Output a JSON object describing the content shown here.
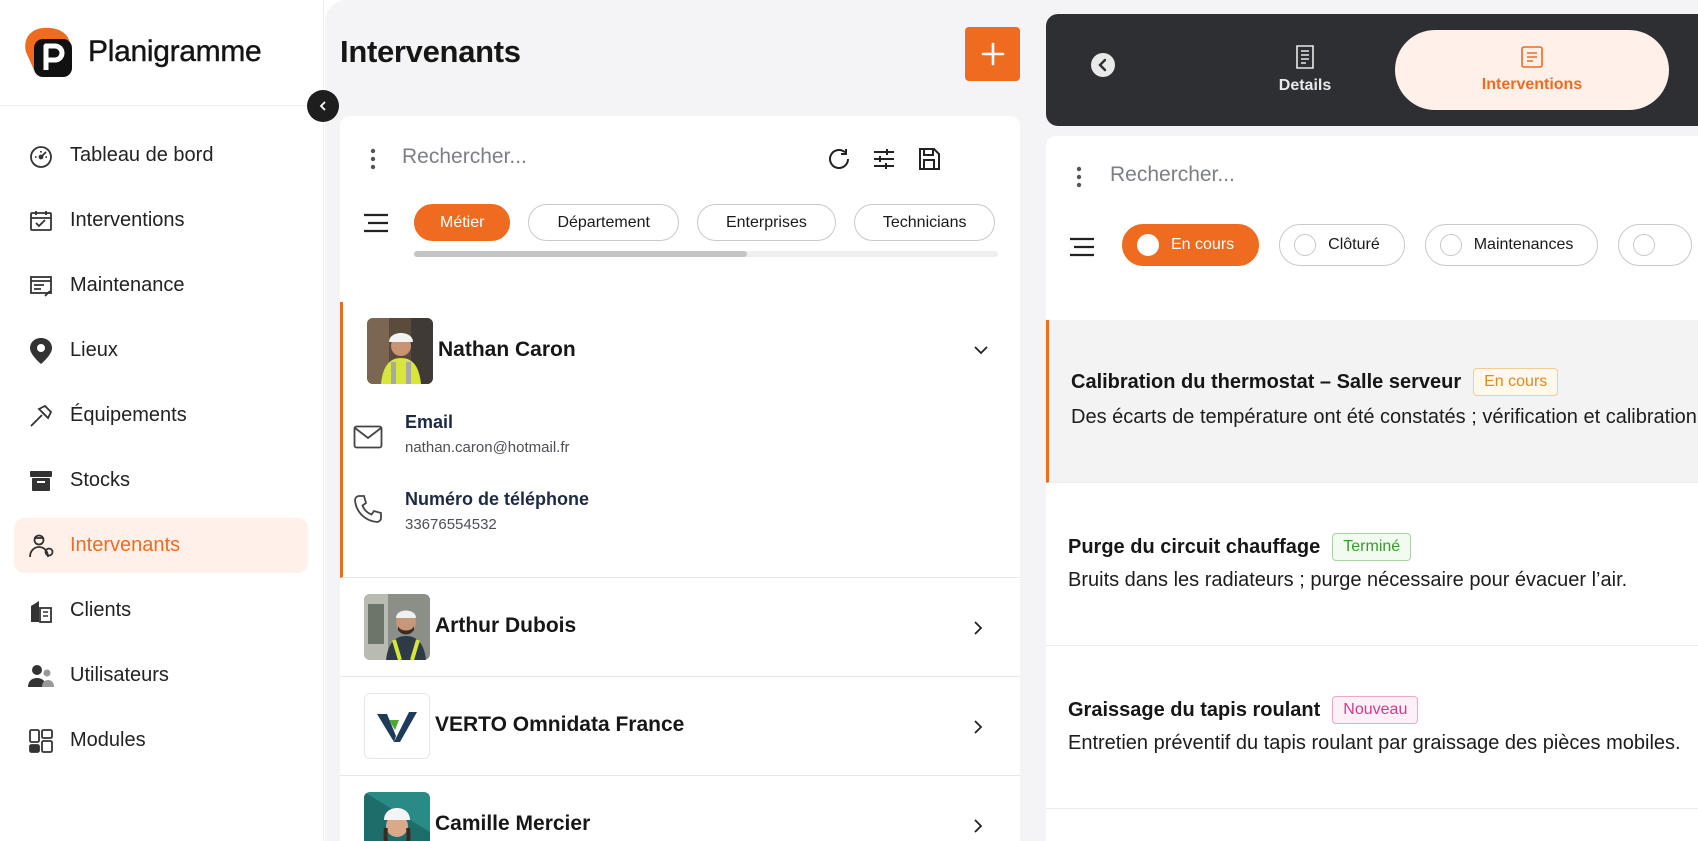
{
  "app": {
    "name": "Planigramme"
  },
  "colors": {
    "accent": "#ef6b20",
    "accent_soft": "#fff1ea",
    "dark_bar": "#2d2f33"
  },
  "sidebar": {
    "collapse_icon": "chevron-left-icon",
    "items": [
      {
        "label": "Tableau de bord",
        "icon": "gauge-icon",
        "active": false
      },
      {
        "label": "Interventions",
        "icon": "calendar-check-icon",
        "active": false
      },
      {
        "label": "Maintenance",
        "icon": "wrench-list-icon",
        "active": false
      },
      {
        "label": "Lieux",
        "icon": "map-pin-icon",
        "active": false
      },
      {
        "label": "Équipements",
        "icon": "hammer-icon",
        "active": false
      },
      {
        "label": "Stocks",
        "icon": "archive-box-icon",
        "active": false
      },
      {
        "label": "Intervenants",
        "icon": "worker-icon",
        "active": true
      },
      {
        "label": "Clients",
        "icon": "building-icon",
        "active": false
      },
      {
        "label": "Utilisateurs",
        "icon": "users-icon",
        "active": false
      },
      {
        "label": "Modules",
        "icon": "modules-grid-icon",
        "active": false
      }
    ]
  },
  "intervenants": {
    "title": "Intervenants",
    "add_icon": "plus-icon",
    "search": {
      "placeholder": "Rechercher..."
    },
    "filters": [
      {
        "label": "Métier",
        "active": true
      },
      {
        "label": "Département",
        "active": false
      },
      {
        "label": "Enterprises",
        "active": false
      },
      {
        "label": "Technicians",
        "active": false
      }
    ],
    "filters_scroll_fraction": 0.57,
    "people": [
      {
        "name": "Nathan Caron",
        "expanded": true,
        "email_label": "Email",
        "email": "nathan.caron@hotmail.fr",
        "phone_label": "Numéro de téléphone",
        "phone": "33676554532"
      },
      {
        "name": "Arthur Dubois",
        "expanded": false
      },
      {
        "name": "VERTO Omnidata France",
        "expanded": false
      },
      {
        "name": "Camille Mercier",
        "expanded": false
      }
    ]
  },
  "detail_panel": {
    "tabs": [
      {
        "label": "Details",
        "icon": "document-icon",
        "active": false
      },
      {
        "label": "Interventions",
        "icon": "list-doc-icon",
        "active": true
      }
    ],
    "search": {
      "placeholder": "Rechercher..."
    },
    "status_filters": [
      {
        "label": "En cours",
        "active": true
      },
      {
        "label": "Clôturé",
        "active": false
      },
      {
        "label": "Maintenances",
        "active": false
      }
    ],
    "interventions": [
      {
        "title": "Calibration du thermostat – Salle serveur",
        "status": "En cours",
        "status_color": "#e08a1e",
        "status_bg": "#fff8ec",
        "description": "Des écarts de température ont été constatés ; vérification et calibration nécessaires."
      },
      {
        "title": "Purge du circuit chauffage",
        "status": "Terminé",
        "status_color": "#3a9a2e",
        "status_bg": "#f1fbef",
        "description": "Bruits dans les radiateurs ; purge nécessaire pour évacuer l’air."
      },
      {
        "title": "Graissage du tapis roulant",
        "status": "Nouveau",
        "status_color": "#d23a8c",
        "status_bg": "#fdf0f7",
        "description": "Entretien préventif du tapis roulant par graissage des pièces mobiles."
      }
    ]
  }
}
